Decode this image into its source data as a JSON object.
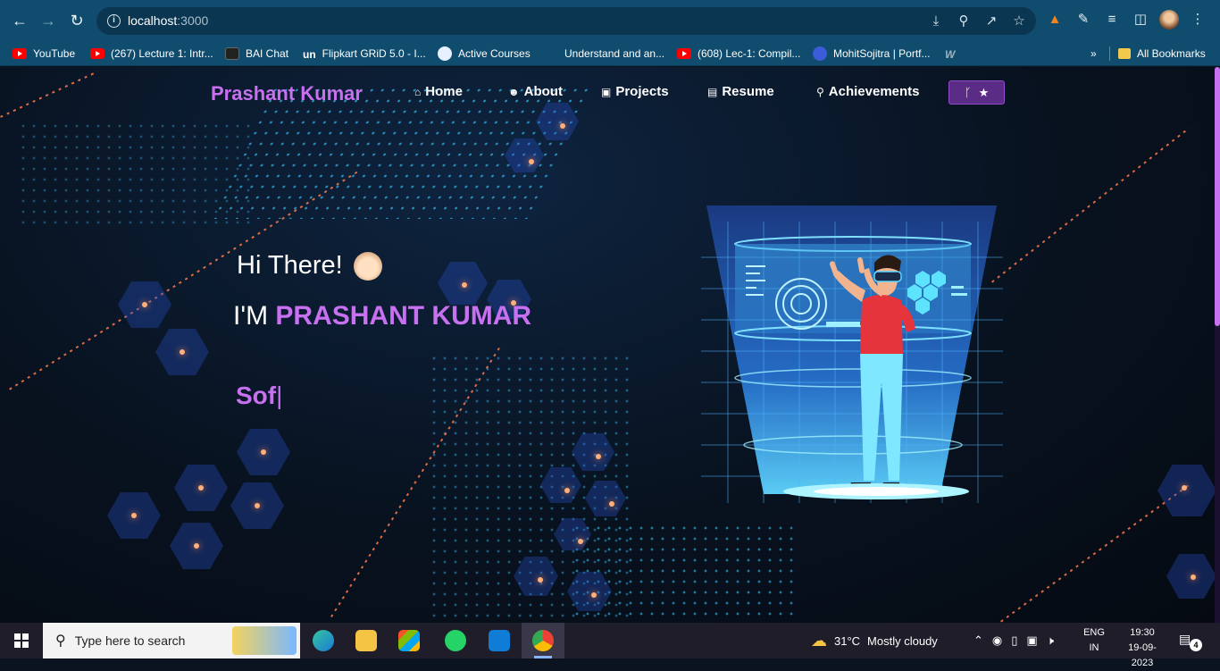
{
  "browser": {
    "url_host": "localhost",
    "url_port": ":3000",
    "bookmarks": [
      {
        "label": "YouTube",
        "icon": "youtube"
      },
      {
        "label": "(267) Lecture 1: Intr...",
        "icon": "youtube"
      },
      {
        "label": "BAI Chat",
        "icon": "bai"
      },
      {
        "label": "Flipkart GRiD 5.0 - I...",
        "icon": "unstop"
      },
      {
        "label": "Active Courses",
        "icon": "course"
      },
      {
        "label": "Understand and an...",
        "icon": "blank"
      },
      {
        "label": "(608) Lec-1: Compil...",
        "icon": "youtube"
      },
      {
        "label": "MohitSojitra | Portf...",
        "icon": "portfolio"
      }
    ],
    "all_bookmarks": "All Bookmarks",
    "bookmark_more": "»"
  },
  "site": {
    "brand": "Prashant Kumar",
    "nav": [
      {
        "label": "Home",
        "icon": "home-icon"
      },
      {
        "label": "About",
        "icon": "user-icon"
      },
      {
        "label": "Projects",
        "icon": "projects-icon"
      },
      {
        "label": "Resume",
        "icon": "document-icon"
      },
      {
        "label": "Achievements",
        "icon": "trophy-icon"
      }
    ],
    "fork_glyph": "ᚴ",
    "star_glyph": "★",
    "greeting": "Hi There!",
    "intro_prefix": "I'M",
    "intro_name": "PRASHANT KUMAR",
    "typed_text": "Sof",
    "typed_cursor": "|",
    "accent": "#c770f0"
  },
  "taskbar": {
    "search_placeholder": "Type here to search",
    "weather_temp": "31°C",
    "weather_text": "Mostly cloudy",
    "lang_1": "ENG",
    "lang_2": "IN",
    "time": "19:30",
    "date": "19-09-2023",
    "notification_count": "4"
  }
}
